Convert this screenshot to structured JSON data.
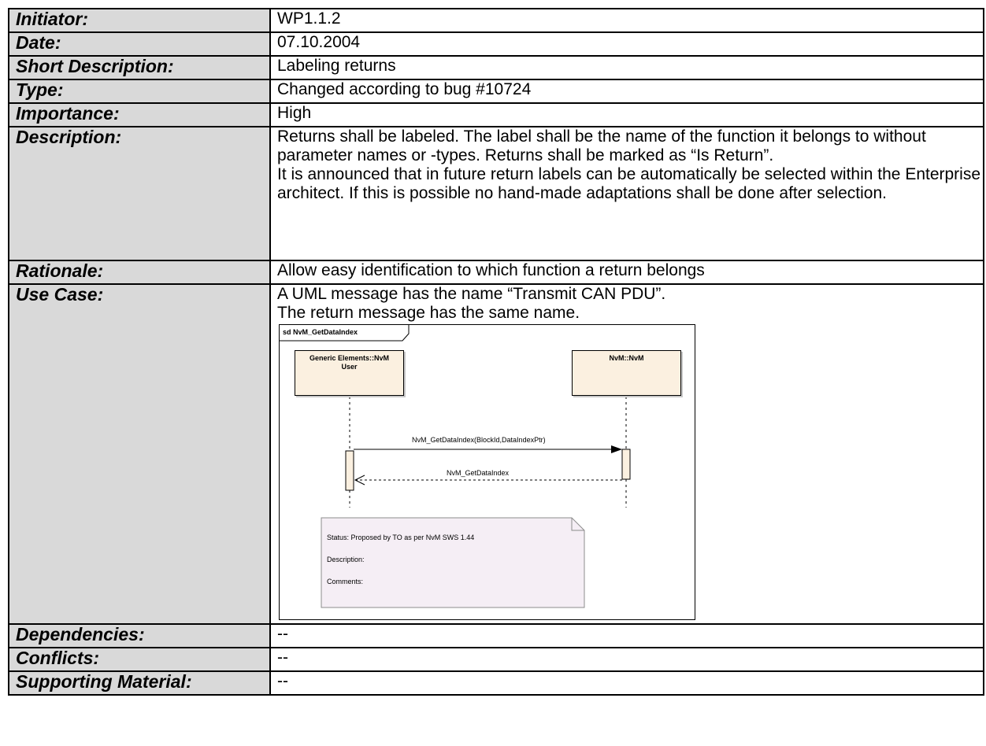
{
  "rows": {
    "initiator": {
      "label": "Initiator:",
      "value": "WP1.1.2"
    },
    "date": {
      "label": "Date:",
      "value": "07.10.2004"
    },
    "short_description": {
      "label": "Short Description:",
      "value": "Labeling returns"
    },
    "type": {
      "label": "Type:",
      "value": "Changed according to bug #10724"
    },
    "importance": {
      "label": "Importance:",
      "value": "High"
    },
    "description": {
      "label": "Description:",
      "paragraphs": [
        "Returns shall be labeled. The label shall be the name of the function it belongs to without parameter names or -types. Returns shall be marked as “Is Return”.",
        "It is announced that in future return labels can be automatically be selected within the Enterprise architect. If this is possible no hand-made adaptations shall be done after selection."
      ]
    },
    "rationale": {
      "label": "Rationale:",
      "value": "Allow easy identification to which function a return belongs"
    },
    "use_case": {
      "label": "Use Case:",
      "lines": [
        "A UML message has the name “Transmit CAN PDU”.",
        "The return message has the same name."
      ]
    },
    "dependencies": {
      "label": "Dependencies:",
      "value": "--"
    },
    "conflicts": {
      "label": "Conflicts:",
      "value": "--"
    },
    "supporting_material": {
      "label": "Supporting Material:",
      "value": "--"
    }
  },
  "diagram": {
    "frame_title": "sd NvM_GetDataIndex",
    "lifeline_left": {
      "line1": "Generic Elements::NvM",
      "line2": "User"
    },
    "lifeline_right": {
      "label": "NvM::NvM"
    },
    "call_message": "NvM_GetDataIndex(BlockId,DataIndexPtr)",
    "return_message": "NvM_GetDataIndex",
    "note": {
      "status": "Status: Proposed by TO as per NvM SWS 1.44",
      "description": "Description:",
      "comments": "Comments:"
    },
    "colors": {
      "lifeline_fill": "#fbf0e0",
      "note_fill": "#f5eef5"
    }
  }
}
